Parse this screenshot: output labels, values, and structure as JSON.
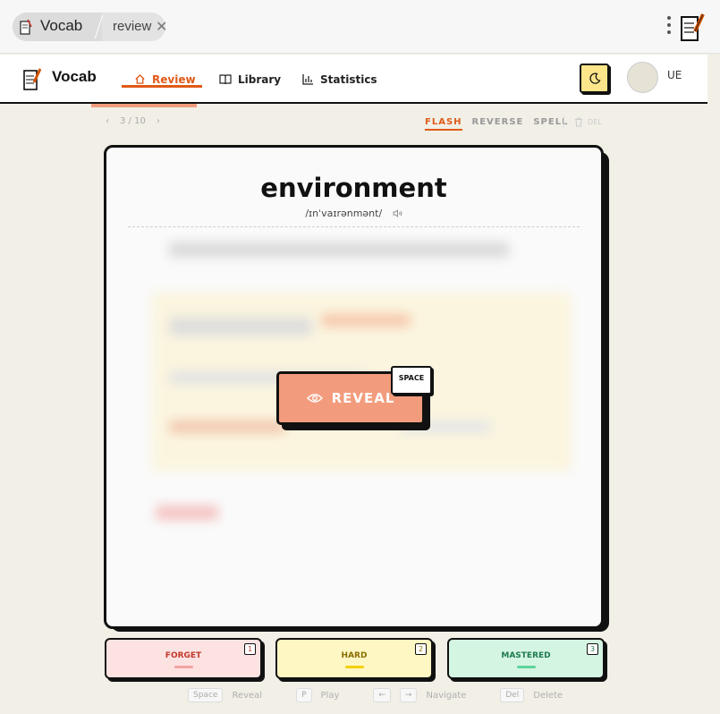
{
  "window": {
    "app_name": "Vocab",
    "tab_label": "review",
    "close_glyph": "✕"
  },
  "header": {
    "brand": "Vocab",
    "nav": [
      {
        "label": "Review",
        "icon": "home-icon",
        "active": true
      },
      {
        "label": "Library",
        "icon": "book-icon",
        "active": false
      },
      {
        "label": "Statistics",
        "icon": "bar-chart-icon",
        "active": false
      }
    ],
    "theme_icon": "moon-icon",
    "user_initials": "UE",
    "accent_color": "#e05a18"
  },
  "toolbar": {
    "prev_glyph": "‹",
    "next_glyph": "›",
    "counter": "3 / 10",
    "modes": [
      {
        "label": "FLASH",
        "active": true
      },
      {
        "label": "REVERSE",
        "active": false
      },
      {
        "label": "SPELL",
        "active": false
      }
    ],
    "delete_label": "DEL"
  },
  "card": {
    "word": "environment",
    "phonetic": "/ɪnˈvaɪrənmənt/",
    "reveal_label": "REVEAL",
    "reveal_shortcut": "SPACE"
  },
  "ratings": [
    {
      "label": "FORGET",
      "key": "1"
    },
    {
      "label": "HARD",
      "key": "2"
    },
    {
      "label": "MASTERED",
      "key": "3"
    }
  ],
  "hints": [
    {
      "key": "Space",
      "action": "Reveal"
    },
    {
      "key": "P",
      "action": "Play"
    },
    {
      "key": "←",
      "key2": "→",
      "action": "Navigate"
    },
    {
      "key": "Del",
      "action": "Delete"
    }
  ]
}
